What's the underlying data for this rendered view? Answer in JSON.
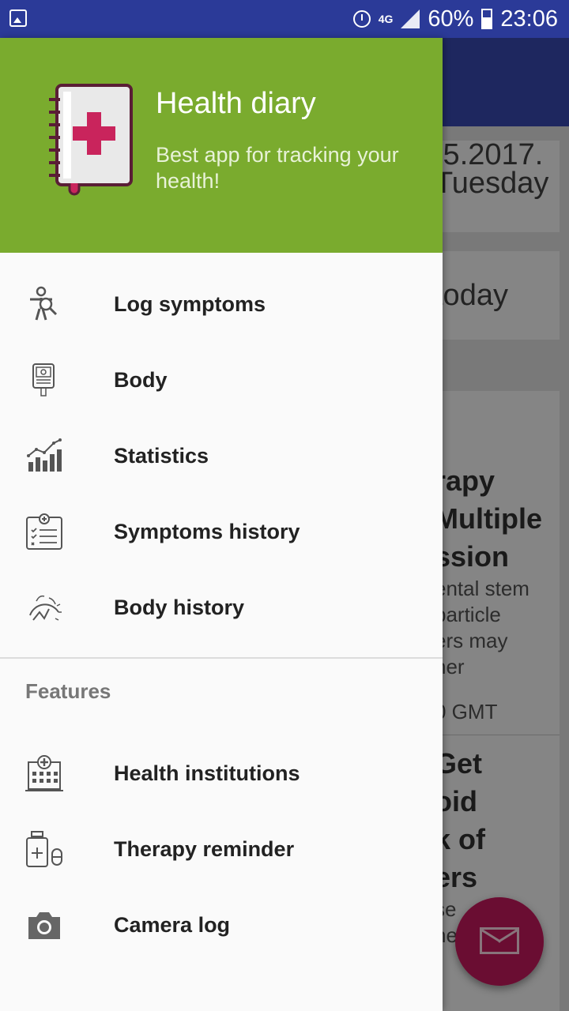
{
  "status_bar": {
    "network": "4G",
    "battery": "60%",
    "time": "23:06"
  },
  "header": {
    "title": "Health diary",
    "subtitle": "Best app for tracking your health!"
  },
  "menu": [
    {
      "label": "Log symptoms",
      "icon": "symptom-search-icon"
    },
    {
      "label": "Body",
      "icon": "glucometer-icon"
    },
    {
      "label": "Statistics",
      "icon": "bar-chart-icon"
    },
    {
      "label": "Symptoms history",
      "icon": "clipboard-icon"
    },
    {
      "label": "Body history",
      "icon": "body-scan-icon"
    }
  ],
  "features": {
    "title": "Features",
    "items": [
      {
        "label": "Health institutions",
        "icon": "hospital-icon"
      },
      {
        "label": "Therapy reminder",
        "icon": "medicine-icon"
      },
      {
        "label": "Camera log",
        "icon": "camera-icon"
      }
    ]
  },
  "background": {
    "date": ".5.2017.",
    "weekday": "Tuesday",
    "today": "today",
    "news_title": [
      "rapy",
      "Multiple",
      "ssion"
    ],
    "news_text": [
      "ental stem",
      "particle",
      "ers may",
      "her"
    ],
    "news_time": "0 GMT",
    "news2_title": [
      "Get",
      "oid",
      "k of",
      "ers"
    ],
    "news2_text": [
      "se",
      "ney"
    ]
  }
}
